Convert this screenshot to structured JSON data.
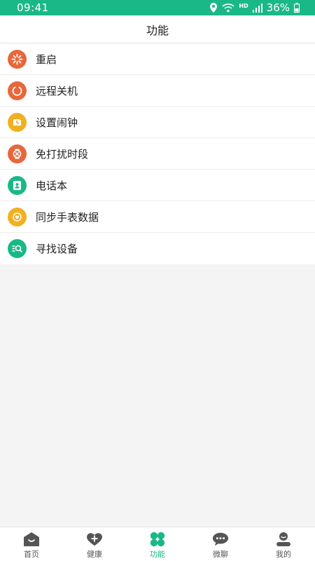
{
  "status_bar": {
    "time": "09:41",
    "network": "HD",
    "battery": "36%"
  },
  "header": {
    "title": "功能"
  },
  "menu": {
    "items": [
      {
        "label": "重启",
        "icon": "restart-icon",
        "color": "#e8673a"
      },
      {
        "label": "远程关机",
        "icon": "power-icon",
        "color": "#e8673a"
      },
      {
        "label": "设置闹钟",
        "icon": "alarm-icon",
        "color": "#f1b021"
      },
      {
        "label": "免打扰时段",
        "icon": "do-not-disturb-icon",
        "color": "#e8673a"
      },
      {
        "label": "电话本",
        "icon": "phonebook-icon",
        "color": "#1bb887"
      },
      {
        "label": "同步手表数据",
        "icon": "sync-icon",
        "color": "#f1b021"
      },
      {
        "label": "寻找设备",
        "icon": "find-device-icon",
        "color": "#1bb887"
      }
    ]
  },
  "tabbar": {
    "items": [
      {
        "label": "首页",
        "icon": "home-icon"
      },
      {
        "label": "健康",
        "icon": "health-icon"
      },
      {
        "label": "功能",
        "icon": "functions-icon",
        "active": true
      },
      {
        "label": "微聊",
        "icon": "chat-icon"
      },
      {
        "label": "我的",
        "icon": "profile-icon"
      }
    ]
  },
  "colors": {
    "accent": "#1bb887",
    "orange": "#e8673a",
    "yellow": "#f1b021",
    "tab_inactive": "#555555"
  }
}
